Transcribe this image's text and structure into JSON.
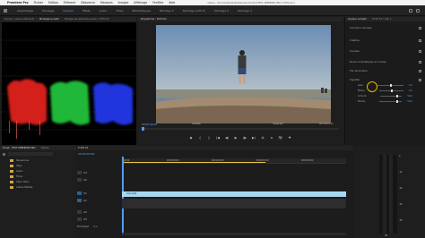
{
  "menubar": {
    "app_name": "Premiere Pro",
    "items": [
      "Fichier",
      "Edition",
      "Elément",
      "Séquence",
      "Marques",
      "Images",
      "Affichage",
      "Fenêtre",
      "Aide"
    ],
    "path": "/Users/.../Documents/Adobe/Premiere Pro/12.0/TEST_PREMIERE_PRO_TUTO.prproj"
  },
  "workspaces": [
    "Assemblage",
    "Montage",
    "Couleur",
    "Effets",
    "Audio",
    "Titres",
    "Bibliothèques",
    "Montage 2",
    "Montage (CS5.5)",
    "Montage 3",
    "Montage 4"
  ],
  "scope_panel": {
    "tabs": [
      "Source : (aucun élément)",
      "Montage Lumetri",
      "Mixage des éléments audio : TUTO 01"
    ],
    "colors": {
      "red": "#e0211f",
      "green": "#22c23a",
      "blue": "#2437e8"
    }
  },
  "program": {
    "tab": "Programme : TUTO 01",
    "timecode_left": "00:00:00:00",
    "fit": "Adapter",
    "quality": "Intégrale",
    "timecode_right": "00:00:03:11",
    "transport": [
      "◆",
      "{",
      "}",
      "|◀",
      "◀|",
      "▶",
      "|▶",
      "▶|",
      "⧉",
      "⧈",
      "📷",
      "✚"
    ]
  },
  "effects": {
    "tabs": [
      "Couleur Lumetri",
      "TUTO 01 * Clip 1"
    ],
    "rows": [
      "Correction de base",
      "Créative",
      "Courbes",
      "Roues chromatiques et corresp.",
      "TSL secondaire",
      "Vignette",
      "Ajuster"
    ],
    "sliders": [
      {
        "label": "Gain",
        "value": "0,0"
      },
      {
        "label": "Milieu",
        "value": "0,0"
      },
      {
        "label": "Arrondi",
        "value": "50,0"
      },
      {
        "label": "Plume",
        "value": "50,0"
      }
    ]
  },
  "project": {
    "tabs": [
      "Projet : TEST PREMIERE PRO",
      "Médias"
    ],
    "search_placeholder": "",
    "items": [
      "Séquences",
      "Clips",
      "Audio",
      "Titres",
      "Clips Vidéo",
      "Autres Médias"
    ],
    "count": "6 éléments"
  },
  "timeline": {
    "tab": "TUTO 01",
    "timecode": "00:00:00:00",
    "ruler_labels": [
      "00:00",
      "00:00:05:00",
      "00:00:10:00",
      "00:00:15:00",
      "00:00:20:00"
    ],
    "tracks": [
      "V3",
      "V2",
      "V1",
      "A1",
      "A2",
      "A3",
      "Principal"
    ],
    "master_value": "0,0",
    "clip_name": "clip.mp4"
  },
  "meter": {
    "labels": [
      "0",
      "-12",
      "-24",
      "-36",
      "-48",
      "dB"
    ]
  }
}
